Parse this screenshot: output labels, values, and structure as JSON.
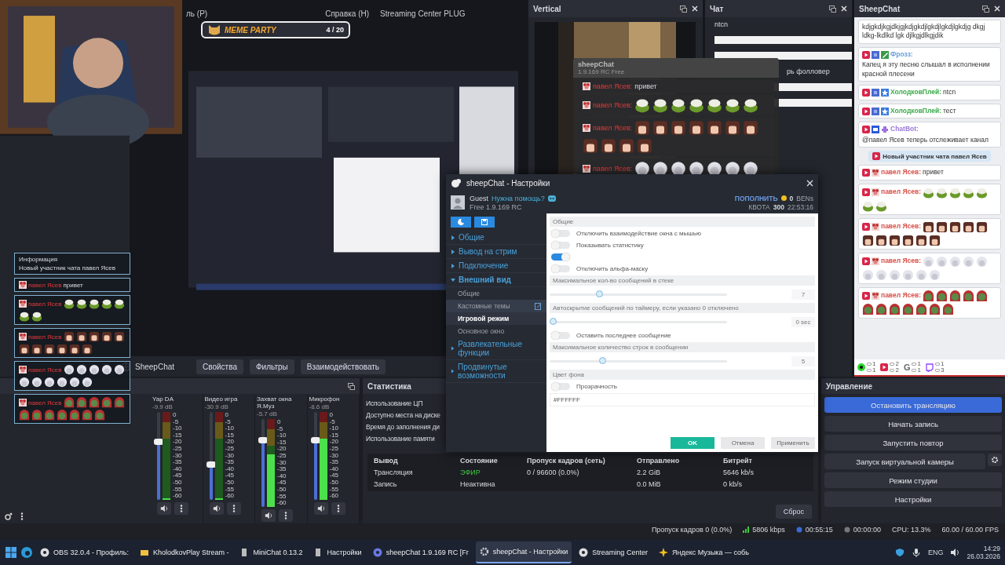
{
  "menu": [
    "ль (P)",
    "Справка (H)",
    "Streaming Center PLUG"
  ],
  "meme_widget": {
    "title": "MEME PARTY",
    "progress": "4 / 20"
  },
  "overlay_chat": [
    {
      "kind": "info",
      "title": "Информация",
      "text": "Новый участник чата павел Ясев"
    },
    {
      "kind": "message",
      "author": "павел Ясев",
      "text": "привет"
    },
    {
      "kind": "message",
      "author": "павел Ясев",
      "emotes": [
        {
          "kind": "frog"
        },
        {
          "kind": "frog"
        },
        {
          "kind": "frog"
        },
        {
          "kind": "frog"
        },
        {
          "kind": "frog"
        },
        {
          "kind": "frog"
        },
        {
          "kind": "frog"
        }
      ]
    },
    {
      "kind": "message",
      "author": "павел Ясев",
      "emotes": [
        {
          "kind": "girl"
        },
        {
          "kind": "girl"
        },
        {
          "kind": "girl"
        },
        {
          "kind": "girl"
        },
        {
          "kind": "girl"
        },
        {
          "kind": "girl"
        },
        {
          "kind": "girl"
        },
        {
          "kind": "girl"
        },
        {
          "kind": "girl"
        },
        {
          "kind": "girl"
        },
        {
          "kind": "girl"
        }
      ]
    },
    {
      "kind": "message",
      "author": "павел Ясев",
      "emotes": [
        {
          "kind": "fluffy"
        },
        {
          "kind": "fluffy"
        },
        {
          "kind": "fluffy"
        },
        {
          "kind": "fluffy"
        },
        {
          "kind": "fluffy"
        },
        {
          "kind": "fluffy"
        },
        {
          "kind": "fluffy"
        },
        {
          "kind": "fluffy"
        },
        {
          "kind": "fluffy"
        },
        {
          "kind": "fluffy"
        },
        {
          "kind": "fluffy"
        }
      ]
    },
    {
      "kind": "message",
      "author": "павел Ясев",
      "emotes": [
        {
          "kind": "pepe"
        },
        {
          "kind": "pepe"
        },
        {
          "kind": "pepe"
        },
        {
          "kind": "pepe"
        },
        {
          "kind": "pepe"
        },
        {
          "kind": "pepe"
        },
        {
          "kind": "pepe"
        },
        {
          "kind": "pepe"
        },
        {
          "kind": "pepe"
        },
        {
          "kind": "pepe"
        },
        {
          "kind": "pepe"
        },
        {
          "kind": "pepe"
        }
      ]
    }
  ],
  "source_bar": {
    "source": "SheepChat",
    "buttons": [
      "Свойства",
      "Фильтры",
      "Взаимодействовать"
    ]
  },
  "vertical_dock": {
    "title": "Vertical"
  },
  "overlay_window": {
    "title": "sheepChat",
    "version": "1.9.169 RC Free",
    "messages": [
      {
        "author": "павел Ясев:",
        "text": "привет"
      },
      {
        "author": "павел Ясев:",
        "emotes": [
          {
            "kind": "frog"
          },
          {
            "kind": "frog"
          },
          {
            "kind": "frog"
          },
          {
            "kind": "frog"
          },
          {
            "kind": "frog"
          },
          {
            "kind": "frog"
          },
          {
            "kind": "frog"
          }
        ]
      },
      {
        "author": "павел Ясев:",
        "emotes": [
          {
            "kind": "girl"
          },
          {
            "kind": "girl"
          },
          {
            "kind": "girl"
          },
          {
            "kind": "girl"
          },
          {
            "kind": "girl"
          },
          {
            "kind": "girl"
          },
          {
            "kind": "girl"
          },
          {
            "kind": "girl"
          },
          {
            "kind": "girl"
          },
          {
            "kind": "girl"
          },
          {
            "kind": "girl"
          }
        ]
      },
      {
        "author": "павел Ясев:",
        "emotes": [
          {
            "kind": "fluffy"
          },
          {
            "kind": "fluffy"
          },
          {
            "kind": "fluffy"
          },
          {
            "kind": "fluffy"
          },
          {
            "kind": "fluffy"
          },
          {
            "kind": "fluffy"
          },
          {
            "kind": "fluffy"
          }
        ]
      }
    ]
  },
  "chat_dock": {
    "title": "Чат",
    "lines": [
      "ntcn",
      "рь фолловер"
    ]
  },
  "sheepchat_dock": {
    "title": "SheepChat",
    "messages": [
      {
        "kind": "message",
        "text": "kdjgkdjkgjdkjgjkdjgkdjlgkdjlgkdjlgkdjg dkgj ldkg-lkdlkd lgk djlkgjdlkgjdik"
      },
      {
        "kind": "message",
        "platform": {
          "kind": "youtube"
        },
        "badges": [
          {
            "kind": "avatar"
          },
          {
            "kind": "pencil"
          }
        ],
        "author": "Фрозз:",
        "color": "#6a9fd8",
        "text": "Капец я эту песню слышал в исполнении красной плесени"
      },
      {
        "kind": "message",
        "platform": {
          "kind": "youtube"
        },
        "badges": [
          {
            "kind": "avatar"
          },
          {
            "kind": "star"
          }
        ],
        "author": "ХолодковПлей:",
        "color": "#3caa4a",
        "text": "ntcn"
      },
      {
        "kind": "message",
        "platform": {
          "kind": "youtube"
        },
        "badges": [
          {
            "kind": "avatar"
          },
          {
            "kind": "star"
          }
        ],
        "author": "ХолодковПлей:",
        "color": "#3caa4a",
        "text": "тест"
      },
      {
        "kind": "message",
        "platform": {
          "kind": "youtube"
        },
        "badges": [
          {
            "kind": "bot"
          },
          {
            "kind": "alien"
          }
        ],
        "author": "ChatBot:",
        "color": "#9a7ad8",
        "text": "@павел Ясев теперь отслеживает канал"
      },
      {
        "kind": "notice",
        "platform": {
          "kind": "youtube"
        },
        "text": "Новый участник чата павел Ясев"
      },
      {
        "kind": "message",
        "platform": {
          "kind": "youtube"
        },
        "badges": [
          {
            "kind": "mouse"
          }
        ],
        "author": "павел Ясев:",
        "color": "#d9504a",
        "text": "привет"
      },
      {
        "kind": "message",
        "platform": {
          "kind": "youtube"
        },
        "badges": [
          {
            "kind": "mouse"
          }
        ],
        "author": "павел Ясев:",
        "color": "#d9504a",
        "emotes": [
          {
            "kind": "frog"
          },
          {
            "kind": "frog"
          },
          {
            "kind": "frog"
          },
          {
            "kind": "frog"
          },
          {
            "kind": "frog"
          },
          {
            "kind": "frog"
          },
          {
            "kind": "frog"
          }
        ]
      },
      {
        "kind": "message",
        "platform": {
          "kind": "youtube"
        },
        "badges": [
          {
            "kind": "mouse"
          }
        ],
        "author": "павел Ясев:",
        "color": "#d9504a",
        "emotes": [
          {
            "kind": "girl"
          },
          {
            "kind": "girl"
          },
          {
            "kind": "girl"
          },
          {
            "kind": "girl"
          },
          {
            "kind": "girl"
          },
          {
            "kind": "girl"
          },
          {
            "kind": "girl"
          },
          {
            "kind": "girl"
          },
          {
            "kind": "girl"
          },
          {
            "kind": "girl"
          },
          {
            "kind": "girl"
          }
        ]
      },
      {
        "kind": "message",
        "platform": {
          "kind": "youtube"
        },
        "badges": [
          {
            "kind": "mouse"
          }
        ],
        "author": "павел Ясев:",
        "color": "#d9504a",
        "emotes": [
          {
            "kind": "fluffy"
          },
          {
            "kind": "fluffy"
          },
          {
            "kind": "fluffy"
          },
          {
            "kind": "fluffy"
          },
          {
            "kind": "fluffy"
          },
          {
            "kind": "fluffy"
          },
          {
            "kind": "fluffy"
          },
          {
            "kind": "fluffy"
          },
          {
            "kind": "fluffy"
          },
          {
            "kind": "fluffy"
          },
          {
            "kind": "fluffy"
          }
        ]
      },
      {
        "kind": "message",
        "platform": {
          "kind": "youtube"
        },
        "badges": [
          {
            "kind": "mouse"
          }
        ],
        "author": "павел Ясев:",
        "color": "#d9504a",
        "emotes": [
          {
            "kind": "pepe"
          },
          {
            "kind": "pepe"
          },
          {
            "kind": "pepe"
          },
          {
            "kind": "pepe"
          },
          {
            "kind": "pepe"
          },
          {
            "kind": "pepe"
          },
          {
            "kind": "pepe"
          },
          {
            "kind": "pepe"
          },
          {
            "kind": "pepe"
          },
          {
            "kind": "pepe"
          },
          {
            "kind": "pepe"
          },
          {
            "kind": "pepe"
          }
        ]
      }
    ],
    "platforms": [
      {
        "kind": "kick",
        "viewers": "1",
        "messages": "1"
      },
      {
        "kind": "youtube",
        "viewers": "2",
        "messages": "2"
      },
      {
        "kind": "google",
        "label": "G",
        "viewers": "1",
        "messages": "1"
      },
      {
        "kind": "twitch",
        "viewers": "1",
        "messages": "3"
      }
    ]
  },
  "mixer": {
    "channels": [
      {
        "name": "Yap DA",
        "db": "-9.9 dB",
        "volume": {
          "level": 0.66
        },
        "meter": {
          "level": 0
        },
        "scale": [
          "0",
          "-5",
          "-10",
          "-15",
          "-20",
          "-25",
          "-30",
          "-35",
          "-40",
          "-45",
          "-50",
          "-55",
          "-60"
        ]
      },
      {
        "name": "Видео игра",
        "db": "-30.9 dB",
        "volume": {
          "level": 0.4
        },
        "meter": {
          "level": 0
        },
        "scale": [
          "0",
          "-5",
          "-10",
          "-15",
          "-20",
          "-25",
          "-30",
          "-35",
          "-40",
          "-45",
          "-50",
          "-55",
          "-60"
        ]
      },
      {
        "name": "Захват окна Я.Муз",
        "db": "-5.7 dB",
        "volume": {
          "level": 0.76
        },
        "meter": {
          "level": 0.6
        },
        "scale": [
          "0",
          "-5",
          "-10",
          "-15",
          "-20",
          "-25",
          "-30",
          "-35",
          "-40",
          "-45",
          "-50",
          "-55",
          "-60"
        ]
      },
      {
        "name": "Микрофон",
        "db": "-8.6 dB",
        "volume": {
          "level": 0.68
        },
        "meter": {
          "level": 0.7
        },
        "scale": [
          "0",
          "-5",
          "-10",
          "-15",
          "-20",
          "-25",
          "-30",
          "-35",
          "-40",
          "-45",
          "-50",
          "-55",
          "-60"
        ]
      }
    ]
  },
  "stats": {
    "title": "Статистика",
    "rows": [
      "Использование ЦП",
      "Доступно места на диске",
      "Время до заполнения ди",
      "Использование памяти"
    ],
    "table": {
      "columns": [
        "Вывод",
        "Состояние",
        "Пропуск кадров (сеть)",
        "Отправлено",
        "Битрейт"
      ],
      "rows": [
        {
          "output": "Трансляция",
          "state": "ЭФИР",
          "dropped": "0 / 96600 (0.0%)",
          "sent": "2.2 GiB",
          "bitrate": "5646 kb/s",
          "live": true
        },
        {
          "output": "Запись",
          "state": "Неактивна",
          "sent": "0.0 MiB",
          "bitrate": "0 kb/s",
          "live": false
        }
      ]
    },
    "reset": "Сброс"
  },
  "controls": {
    "title": "Управление",
    "buttons": [
      {
        "label": "Остановить трансляцию",
        "active": true
      },
      {
        "label": "Начать запись",
        "active": false
      },
      {
        "label": "Запустить повтор",
        "active": false
      },
      {
        "label": "Запуск виртуальной камеры",
        "active": false,
        "settings": true
      },
      {
        "label": "Режим студии",
        "active": false
      },
      {
        "label": "Настройки",
        "active": false
      }
    ]
  },
  "status_bar": [
    "Пропуск кадров 0 (0.0%)",
    "5806 kbps",
    "00:55:15",
    "00:00:00",
    "CPU: 13.3%",
    "60.00 / 60.00 FPS"
  ],
  "dialog": {
    "title": "sheepChat - Настройки",
    "user": "Guest",
    "help": "Нужна помощь?",
    "version": "Free 1.9.169 RC",
    "topup": "ПОПОЛНИТЬ",
    "balance": "0",
    "currency": "BENs",
    "quota_label": "КВОТА",
    "quota": "300",
    "timer": "22:53:16",
    "nav": [
      {
        "label": "Общие",
        "expanded": false
      },
      {
        "label": "Вывод на стрим",
        "expanded": false
      },
      {
        "label": "Подключение",
        "expanded": false
      },
      {
        "label": "Внешний вид",
        "expanded": true,
        "children": [
          {
            "label": "Общие",
            "selected": false,
            "hovered": false
          },
          {
            "label": "Кастомные темы",
            "selected": false,
            "hovered": true
          },
          {
            "label": "Игровой режим",
            "selected": true,
            "hovered": false
          },
          {
            "label": "Основное окно",
            "selected": false,
            "hovered": false
          }
        ]
      },
      {
        "label": "Развлекательные функции",
        "expanded": false
      },
      {
        "label": "Продвинутые возможности",
        "expanded": false
      }
    ],
    "sections": [
      {
        "title": "Общие",
        "items": [
          {
            "kind": "toggle",
            "label": "Отключить взаимодействие окна с мышью",
            "on": false
          },
          {
            "kind": "toggle",
            "label": "Показывать статистику",
            "on": false
          },
          {
            "kind": "toggle",
            "on": true
          },
          {
            "kind": "toggle",
            "label": "Отключить альфа-маску",
            "on": false
          }
        ]
      },
      {
        "title": "Максимальное кол-во сообщений в стеке",
        "items": [
          {
            "kind": "slider",
            "level": 0.27,
            "value": "7"
          }
        ]
      },
      {
        "title": "Автоскрытие сообщений по таймеру, если указано 0 отключено",
        "items": [
          {
            "kind": "slider",
            "level": 0,
            "value": "0 sec"
          },
          {
            "kind": "toggle",
            "label": "Оставить последнее сообщение",
            "on": false
          }
        ]
      },
      {
        "title": "Максимальное количество строк в сообщении",
        "items": [
          {
            "kind": "slider",
            "level": 0.29,
            "value": "5"
          }
        ]
      },
      {
        "title": "Цвет фона",
        "items": [
          {
            "kind": "toggle",
            "label": "Прозрачность",
            "on": false
          },
          {
            "kind": "field",
            "value": "#FFFFFF"
          }
        ]
      }
    ],
    "buttons": [
      {
        "label": "OK",
        "kind": "primary"
      },
      {
        "label": "Отмена",
        "kind": "secondary"
      },
      {
        "label": "Применить",
        "kind": "secondary"
      }
    ]
  },
  "taskbar": {
    "apps": [
      {
        "label": "OBS 32.0.4 - Профиль:",
        "kind": "obs",
        "selected": false
      },
      {
        "label": "KholodkovPlay Stream -",
        "kind": "folder",
        "selected": false
      },
      {
        "label": "MiniChat 0.13.2",
        "kind": "doc",
        "selected": false
      },
      {
        "label": "Настройки",
        "kind": "doc",
        "selected": false
      },
      {
        "label": "sheepChat 1.9.169 RC [Fr",
        "kind": "sheep",
        "selected": false
      },
      {
        "label": "sheepChat - Настройки",
        "kind": "gear",
        "selected": true
      },
      {
        "label": "Streaming Center",
        "kind": "disc",
        "selected": false
      },
      {
        "label": "Яндекс Музыка — собь",
        "kind": "star",
        "selected": false
      }
    ],
    "lang": "ENG",
    "time": "14:29",
    "date": "26.03.2026"
  }
}
